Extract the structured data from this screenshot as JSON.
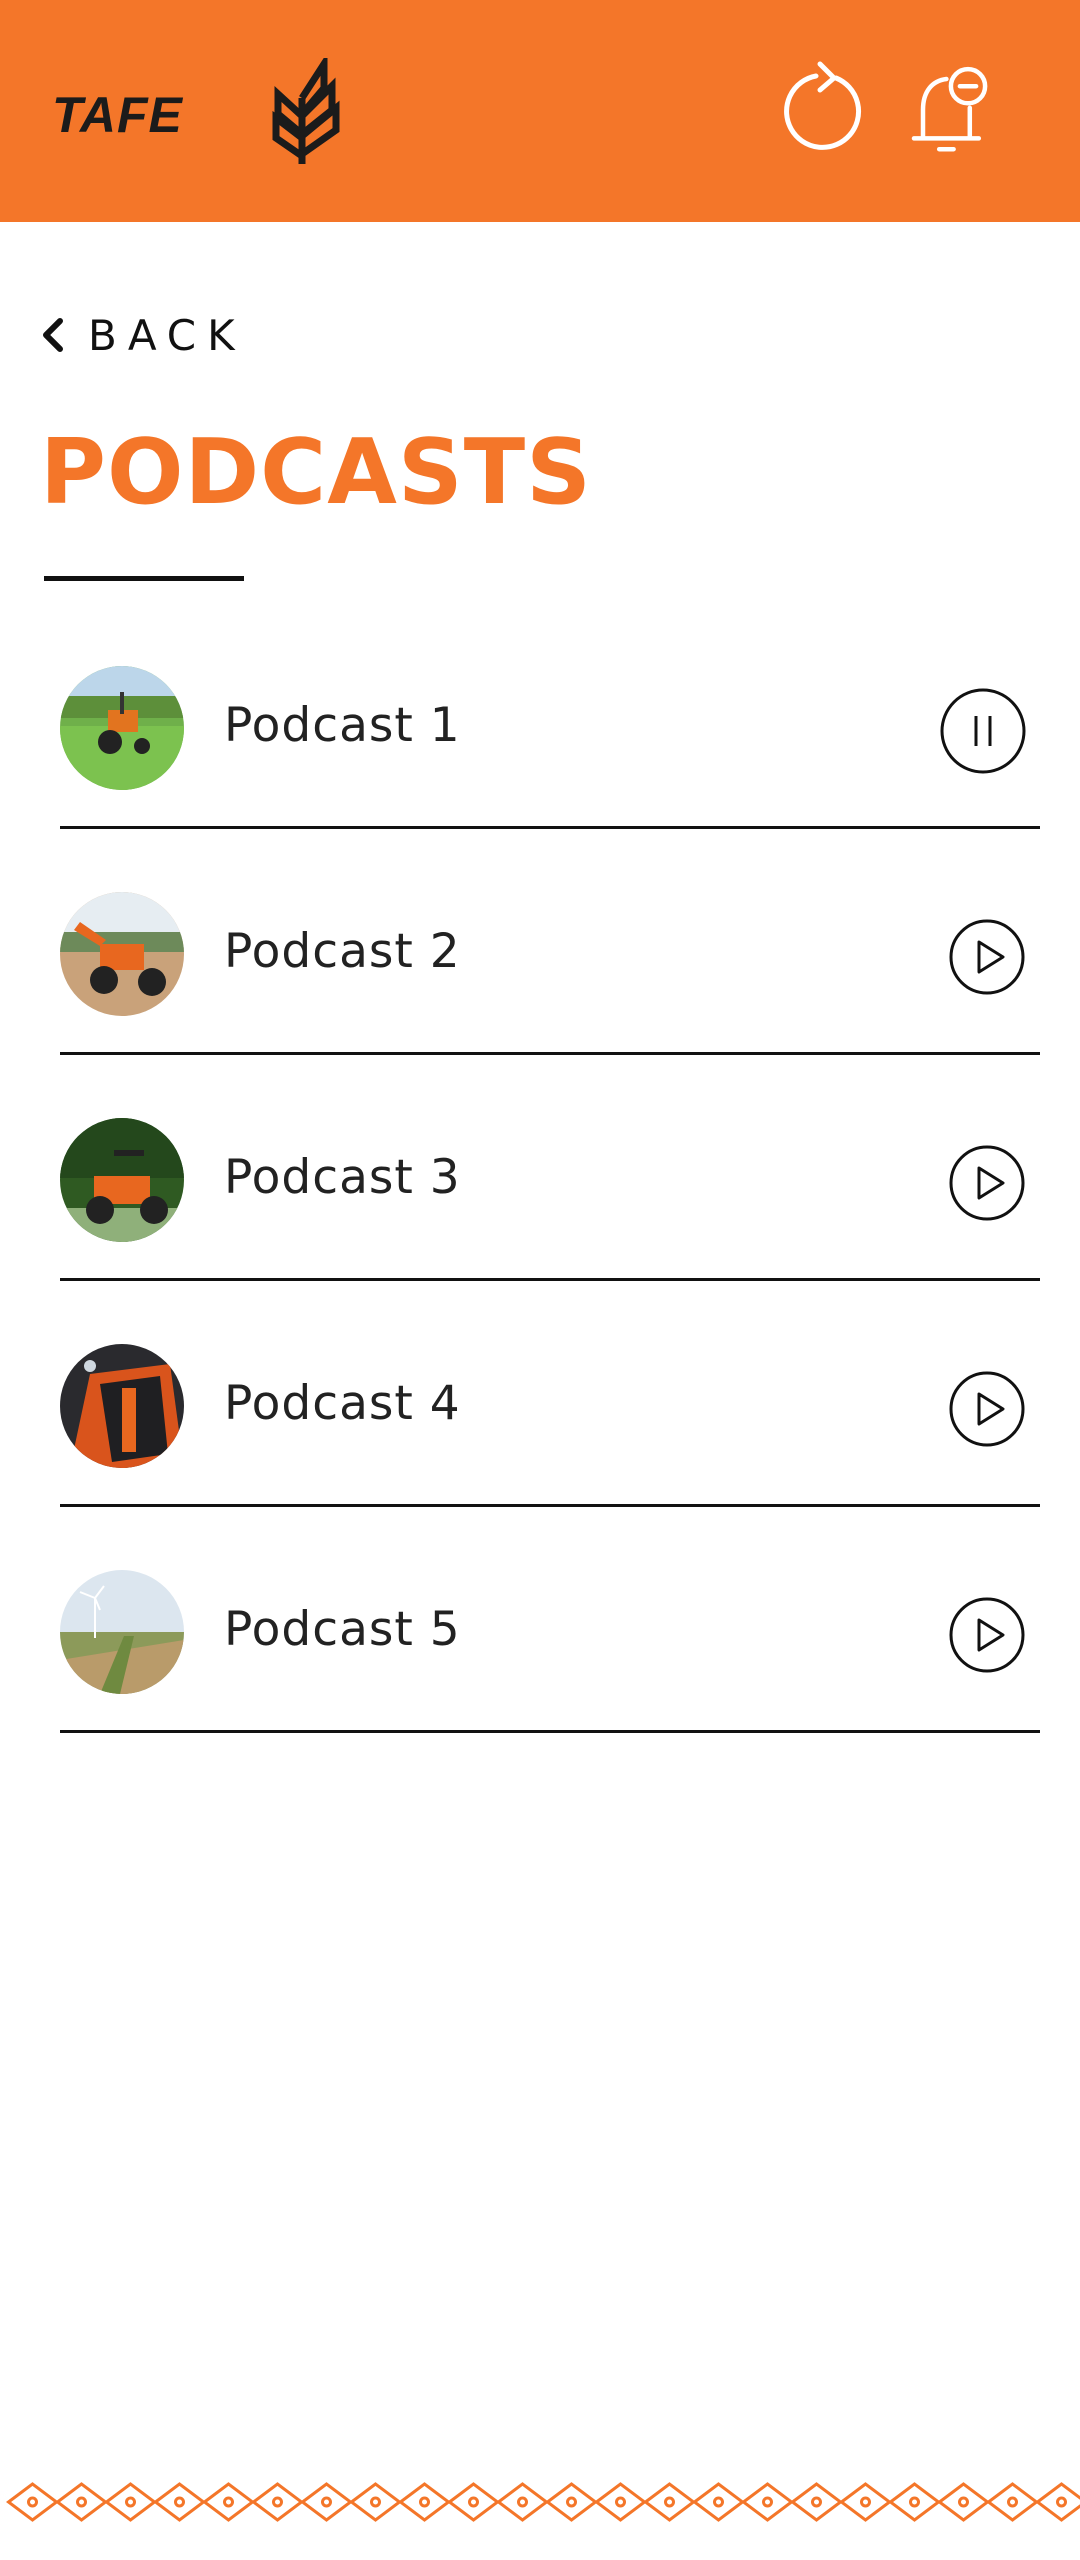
{
  "header": {
    "brand_text": "TAFE",
    "logo_icon": "wheat-icon",
    "refresh_icon": "refresh-icon",
    "notification_icon": "bell-minus-icon",
    "background_color": "#f47629"
  },
  "nav": {
    "back_label": "BACK",
    "back_icon": "chevron-left-icon"
  },
  "page": {
    "title": "PODCASTS",
    "title_color": "#f47629"
  },
  "podcasts": [
    {
      "title": "Podcast 1",
      "state": "playing",
      "control_icon": "pause-icon",
      "thumbnail": "tractor-in-grass-field"
    },
    {
      "title": "Podcast 2",
      "state": "stopped",
      "control_icon": "play-icon",
      "thumbnail": "tractor-with-loader"
    },
    {
      "title": "Podcast 3",
      "state": "stopped",
      "control_icon": "play-icon",
      "thumbnail": "tractor-in-forest"
    },
    {
      "title": "Podcast 4",
      "state": "stopped",
      "control_icon": "play-icon",
      "thumbnail": "tractor-closeup-dark"
    },
    {
      "title": "Podcast 5",
      "state": "stopped",
      "control_icon": "play-icon",
      "thumbnail": "wind-turbine-farmland"
    }
  ],
  "footer": {
    "pattern": "diamond-chain-pattern",
    "accent": "#f47629"
  }
}
